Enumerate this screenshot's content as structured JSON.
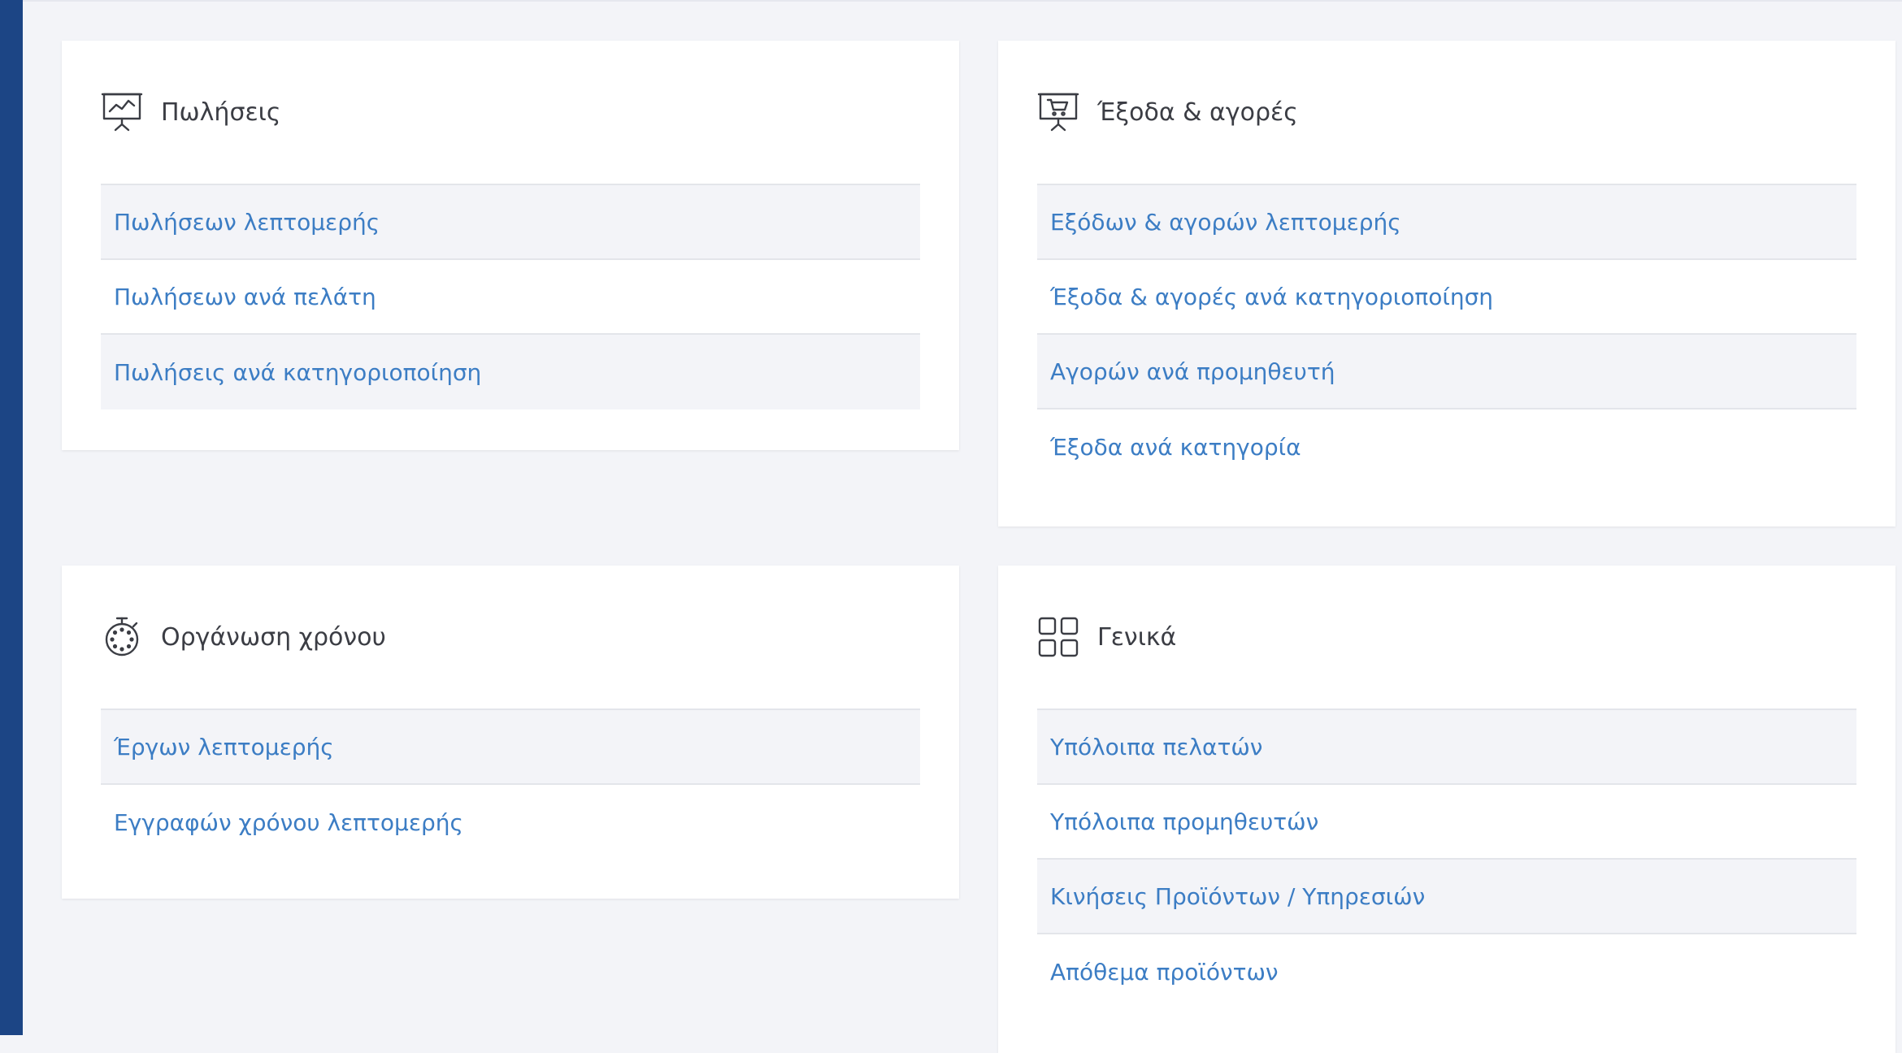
{
  "theme": {
    "accent_link": "#3c7dc4",
    "sidebar": "#1c4585",
    "background": "#f3f4f8"
  },
  "cards": {
    "sales": {
      "icon": "presentation-chart-icon",
      "title": "Πωλήσεις",
      "items": [
        "Πωλήσεων λεπτομερής",
        "Πωλήσεων ανά πελάτη",
        "Πωλήσεις ανά κατηγοριοποίηση"
      ]
    },
    "expenses": {
      "icon": "presentation-cart-icon",
      "title": "Έξοδα & αγορές",
      "items": [
        "Εξόδων & αγορών λεπτομερής",
        "Έξοδα & αγορές ανά κατηγοριοποίηση",
        "Αγορών ανά προμηθευτή",
        "Έξοδα ανά κατηγορία"
      ]
    },
    "time": {
      "icon": "stopwatch-icon",
      "title": "Οργάνωση χρόνου",
      "items": [
        "Έργων λεπτομερής",
        "Εγγραφών χρόνου λεπτομερής"
      ]
    },
    "general": {
      "icon": "grid-icon",
      "title": "Γενικά",
      "items": [
        "Υπόλοιπα πελατών",
        "Υπόλοιπα προμηθευτών",
        "Κινήσεις Προϊόντων / Υπηρεσιών",
        "Απόθεμα προϊόντων"
      ]
    }
  }
}
